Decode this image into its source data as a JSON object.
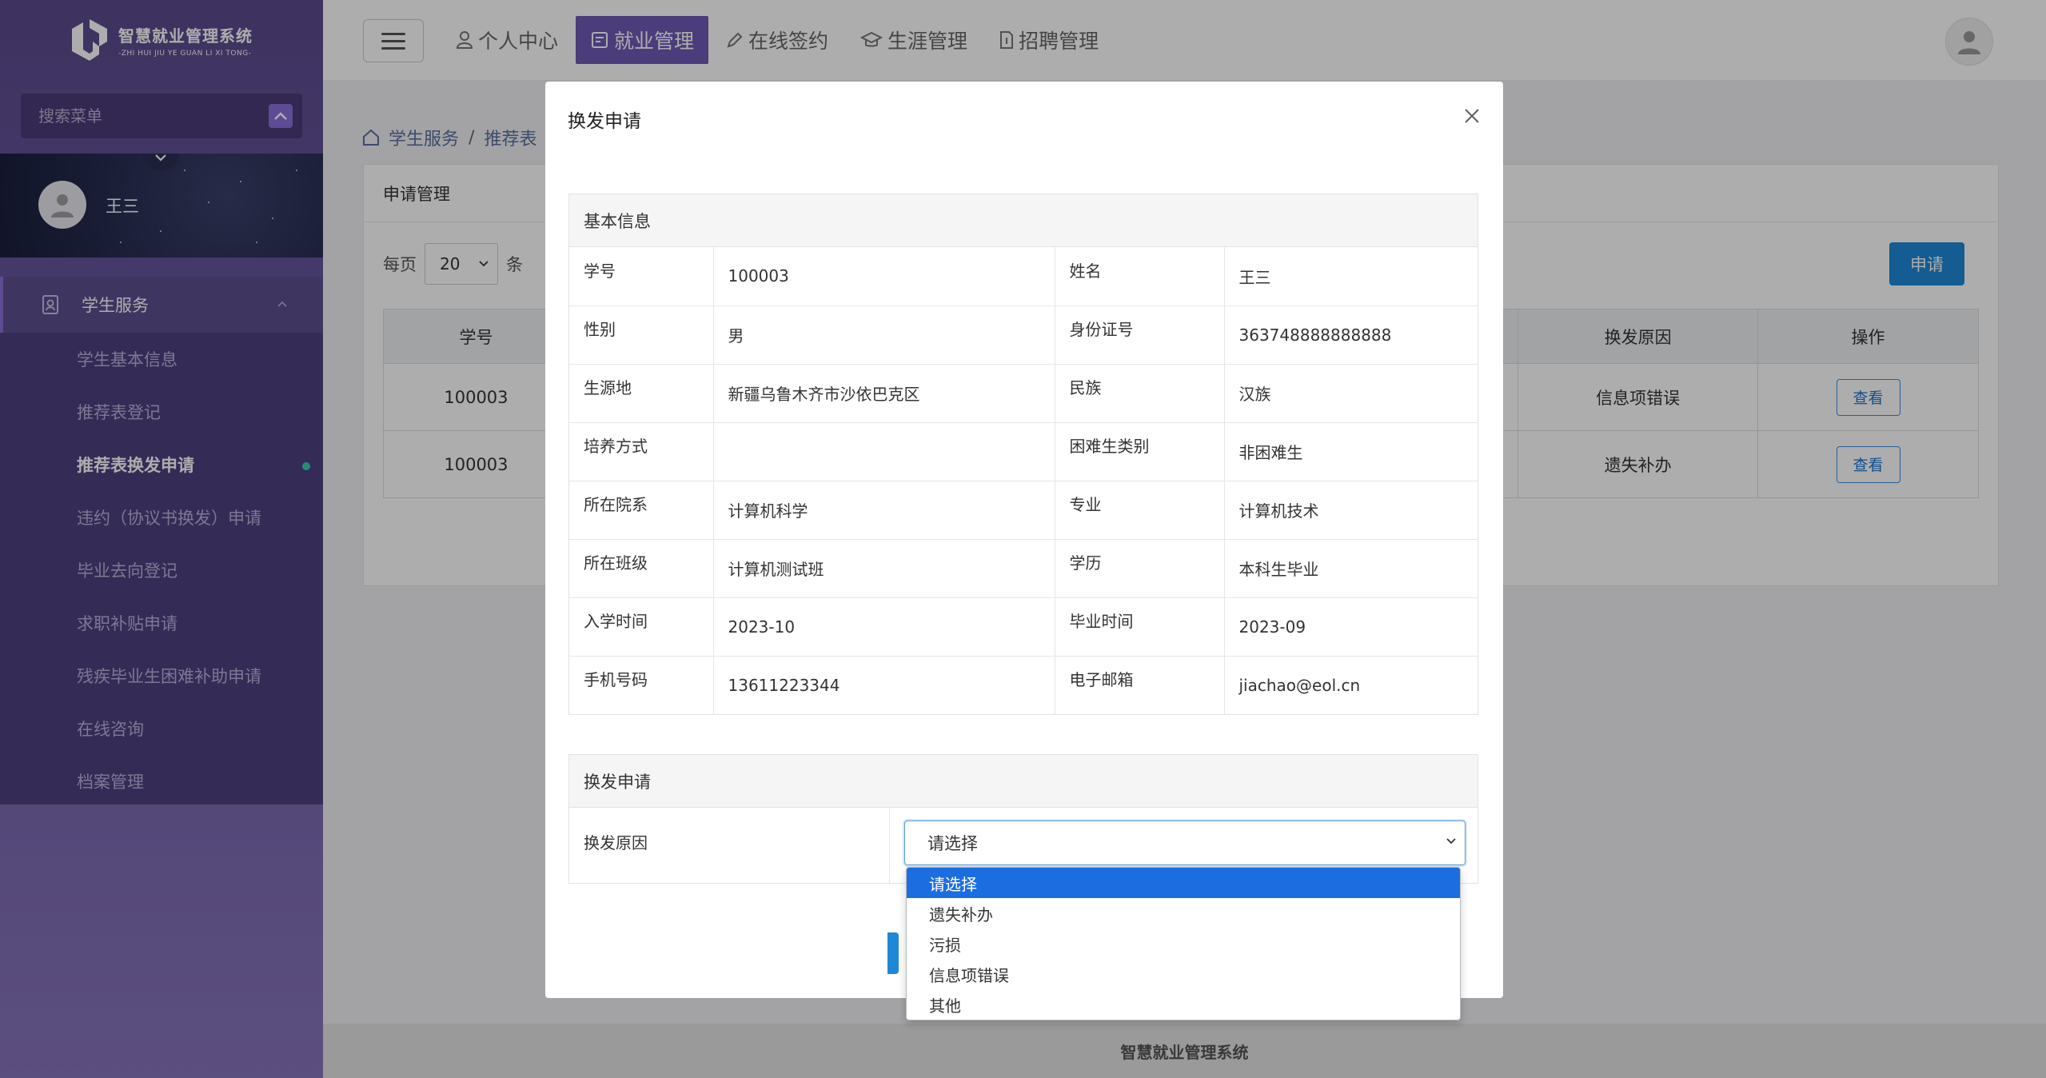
{
  "sidebar": {
    "logo_title": "智慧就业管理系统",
    "logo_subtitle": "-ZHI HUI JIU YE GUAN LI XI TONG-",
    "search_placeholder": "搜索菜单",
    "user_name": "王三",
    "menu_group": "学生服务",
    "menu_items": [
      "学生基本信息",
      "推荐表登记",
      "推荐表换发申请",
      "违约（协议书换发）申请",
      "毕业去向登记",
      "求职补贴申请",
      "残疾毕业生困难补助申请",
      "在线咨询",
      "档案管理"
    ],
    "active_item": "推荐表换发申请"
  },
  "topnav": {
    "items": [
      "个人中心",
      "就业管理",
      "在线签约",
      "生涯管理",
      "招聘管理"
    ],
    "active": "就业管理"
  },
  "breadcrumb": [
    "学生服务",
    "推荐表"
  ],
  "card": {
    "title": "申请管理",
    "page_size_prefix": "每页",
    "page_size_value": "20",
    "page_size_suffix": "条",
    "apply_button": "申请",
    "table": {
      "headers": [
        "学号",
        "换发原因",
        "操作"
      ],
      "rows": [
        {
          "student_id": "100003",
          "reason": "信息项错误",
          "action": "查看"
        },
        {
          "student_id": "100003",
          "reason": "遗失补办",
          "action": "查看"
        }
      ]
    }
  },
  "modal": {
    "title": "换发申请",
    "basic_section": "基本信息",
    "fields": [
      [
        "学号",
        "100003",
        "姓名",
        "王三"
      ],
      [
        "性别",
        "男",
        "身份证号",
        "363748888888888"
      ],
      [
        "生源地",
        "新疆乌鲁木齐市沙依巴克区",
        "民族",
        "汉族"
      ],
      [
        "培养方式",
        "",
        "困难生类别",
        "非困难生"
      ],
      [
        "所在院系",
        "计算机科学",
        "专业",
        "计算机技术"
      ],
      [
        "所在班级",
        "计算机测试班",
        "学历",
        "本科生毕业"
      ],
      [
        "入学时间",
        "2023-10",
        "毕业时间",
        "2023-09"
      ],
      [
        "手机号码",
        "13611223344",
        "电子邮箱",
        "jiachao@eol.cn"
      ]
    ],
    "reissue_section": "换发申请",
    "reason_label": "换发原因",
    "reason_selected": "请选择",
    "reason_options": [
      "请选择",
      "遗失补办",
      "污损",
      "信息项错误",
      "其他"
    ]
  },
  "footer": "智慧就业管理系统",
  "colors": {
    "sidebar": "#5b4a8e",
    "accent": "#6f59b6",
    "primary_button": "#1e88d6",
    "dropdown_selected": "#1c6ee0",
    "active_dot": "#2cd7a8"
  }
}
